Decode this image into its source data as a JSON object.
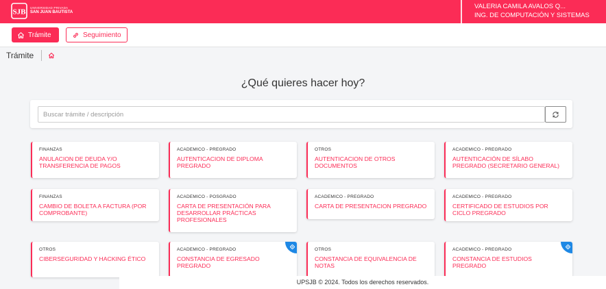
{
  "brand": {
    "line1": "UNIVERSIDAD PRIVADA",
    "line2": "SAN JUAN BAUTISTA",
    "logo_icon": "usjb-logo-icon"
  },
  "user": {
    "name": "VALERIA CAMILA AVALOS Q...",
    "program": "ING. DE COMPUTACIÓN Y SISTEMAS"
  },
  "actions": {
    "tramite_label": "Trámite",
    "tramite_icon": "home-icon",
    "seguimiento_label": "Seguimiento",
    "seguimiento_icon": "link-icon"
  },
  "breadcrumb": {
    "title": "Trámite",
    "home_icon": "home-icon"
  },
  "headline": "¿Qué quieres hacer hoy?",
  "search": {
    "placeholder": "Buscar trámite / descripción",
    "value": "",
    "refresh_icon": "refresh-icon"
  },
  "cards": [
    {
      "category": "FINANZAS",
      "title": "ANULACION DE DEUDA Y/O TRANSFERENCIA DE PAGOS",
      "badge": false
    },
    {
      "category": "ACADEMICO - PREGRADO",
      "title": "AUTENTICACION DE DIPLOMA PREGRADO",
      "badge": false
    },
    {
      "category": "OTROS",
      "title": "AUTENTICACION DE OTROS DOCUMENTOS",
      "badge": false
    },
    {
      "category": "ACADEMICO - PREGRADO",
      "title": "AUTENTICACIÓN DE SÍLABO PREGRADO (SECRETARIO GENERAL)",
      "badge": false
    },
    {
      "category": "FINANZAS",
      "title": "CAMBIO DE BOLETA A FACTURA (POR COMPROBANTE)",
      "badge": false
    },
    {
      "category": "ACADEMICO - POSGRADO",
      "title": "CARTA DE PRESENTACIÓN PARA DESARROLLAR PRÁCTICAS PROFESIONALES",
      "badge": false
    },
    {
      "category": "ACADEMICO - PREGRADO",
      "title": "CARTA DE PRESENTACION PREGRADO",
      "badge": false
    },
    {
      "category": "ACADEMICO - PREGRADO",
      "title": "CERTIFICADO DE ESTUDIOS POR CICLO PREGRADO",
      "badge": false
    },
    {
      "category": "OTROS",
      "title": "CIBERSEGURIDAD Y HACKING ÉTICO",
      "badge": false
    },
    {
      "category": "ACADEMICO - PREGRADO",
      "title": "CONSTANCIA DE EGRESADO PREGRADO",
      "badge": true
    },
    {
      "category": "OTROS",
      "title": "CONSTANCIA DE EQUIVALENCIA DE NOTAS",
      "badge": false
    },
    {
      "category": "ACADEMICO - PREGRADO",
      "title": "CONSTANCIA DE ESTUDIOS PREGRADO",
      "badge": true
    }
  ],
  "badge_icon": "verified-icon",
  "footer": "UPSJB © 2024. Todos los derechos reservados.",
  "colors": {
    "brand": "#fb2c56",
    "badge": "#1e88e5",
    "background": "#f4f5f7"
  }
}
